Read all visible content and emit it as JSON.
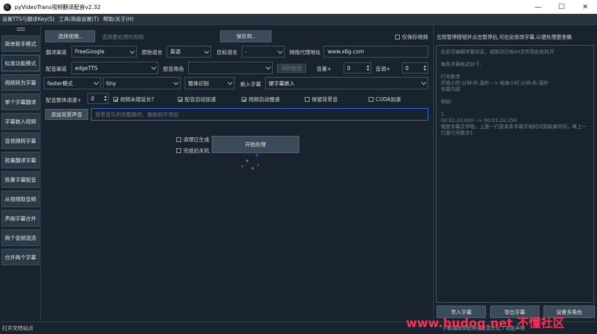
{
  "window": {
    "title": "pyVideoTrans视频翻译配音v2.32",
    "minimize": "—",
    "maximize": "☐",
    "close": "✕"
  },
  "menu": [
    "设置TTS与翻译Key(S)",
    "工具/高级设置(T)",
    "帮助/关于(H)"
  ],
  "sidebar": [
    "简单新手模式",
    "标准功能模式",
    "视频转为字幕",
    "单个字幕翻译",
    "字幕嵌入视频",
    "音视频转字幕",
    "批量翻译字幕",
    "批量字幕配音",
    "从视频取音频",
    "声画字幕合并",
    "两个音频混流",
    "合并两个字幕"
  ],
  "toolbar": {
    "select_video": "选择视频..",
    "select_hint": "选择要处理的视频",
    "save_to": "保存到..",
    "only_save_video": "仅保存视频"
  },
  "row1": {
    "trans_channel_label": "翻译渠道",
    "trans_channel": "FreeGoogle",
    "src_lang_label": "原始语言",
    "src_lang": "英语",
    "target_lang_label": "目标语言",
    "target_lang": "-",
    "proxy_label": "网络代理地址",
    "proxy": "www.x6g.com"
  },
  "row2": {
    "tts_channel_label": "配音渠道",
    "tts_channel": "edgeTTS",
    "voice_role_label": "配音角色",
    "voice_role": "",
    "try_dub": "试听配音",
    "volume_label": "音量+",
    "volume": "0",
    "pitch_label": "音调+",
    "pitch": "0"
  },
  "row3": {
    "mode": "faster模式",
    "model": "tiny",
    "recog": "整体识别",
    "embed_label": "嵌入字幕",
    "embed": "硬字幕嵌入"
  },
  "row4": {
    "speed_label": "配音整体语速+",
    "speed": "0",
    "video_extend": "视频末尾延长?",
    "audio_auto_speed": "配音自动加速",
    "video_auto_slow": "视频自动慢速",
    "keep_bg": "保留背景音",
    "cuda": "CUDA加速"
  },
  "bg": {
    "add_bg": "添加背景声音",
    "placeholder": "背景音乐的完整路径，删除则不添加"
  },
  "actions": {
    "clean_generated": "清理已生成",
    "shutdown_after": "完成后关机",
    "start": "开始处理"
  },
  "right": {
    "hint": "出现暂停按钮并点击暂停后,可在此修改字幕,以便处理更准确",
    "editor_text": "在此可编辑字幕信息，或拖动已有srt文件到此处松开\n\n每条字幕格式如下:\n\n行号数字\n开始小时:分钟:秒,毫秒 --> 结束小时:分钟:秒,毫秒\n字幕内容\n\n例如:\n\n1\n00:01:10,000 --> 00:01:20,150\n我是字幕文字啦，上面一行是本条字幕开始时间到结束时间，再上一行是行号数字1",
    "import_sub": "导入字幕",
    "export_sub": "导出字幕",
    "set_role": "设置多角色"
  },
  "status": {
    "left": "打开文档站点",
    "right": "小都捐赠帮助得很愿意优化 / 视盖声明"
  },
  "watermark": "www.budog.net 不懂社区"
}
